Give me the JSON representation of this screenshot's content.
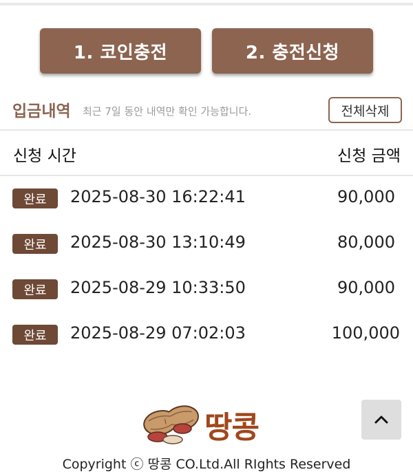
{
  "buttons": {
    "coin_charge": "1. 코인충전",
    "charge_request": "2. 충전신청"
  },
  "history": {
    "title": "입금내역",
    "note": "최근 7일 동안 내역만 확인 가능합니다.",
    "delete_all": "전체삭제"
  },
  "table": {
    "headers": {
      "time": "신청 시간",
      "amount": "신청 금액"
    },
    "rows": [
      {
        "status": "완료",
        "time": "2025-08-30 16:22:41",
        "amount": "90,000"
      },
      {
        "status": "완료",
        "time": "2025-08-30 13:10:49",
        "amount": "80,000"
      },
      {
        "status": "완료",
        "time": "2025-08-29 10:33:50",
        "amount": "90,000"
      },
      {
        "status": "완료",
        "time": "2025-08-29 07:02:03",
        "amount": "100,000"
      }
    ]
  },
  "footer": {
    "logo_text": "땅콩",
    "copyright": "Copyright ⓒ 땅콩 CO.Ltd.All RIghts Reserved"
  },
  "colors": {
    "brand": "#8c6450",
    "badge": "#6e4936",
    "logo": "#a0471c"
  },
  "icons": {
    "scroll_top": "chevron-up-icon",
    "logo": "peanut-icon"
  }
}
